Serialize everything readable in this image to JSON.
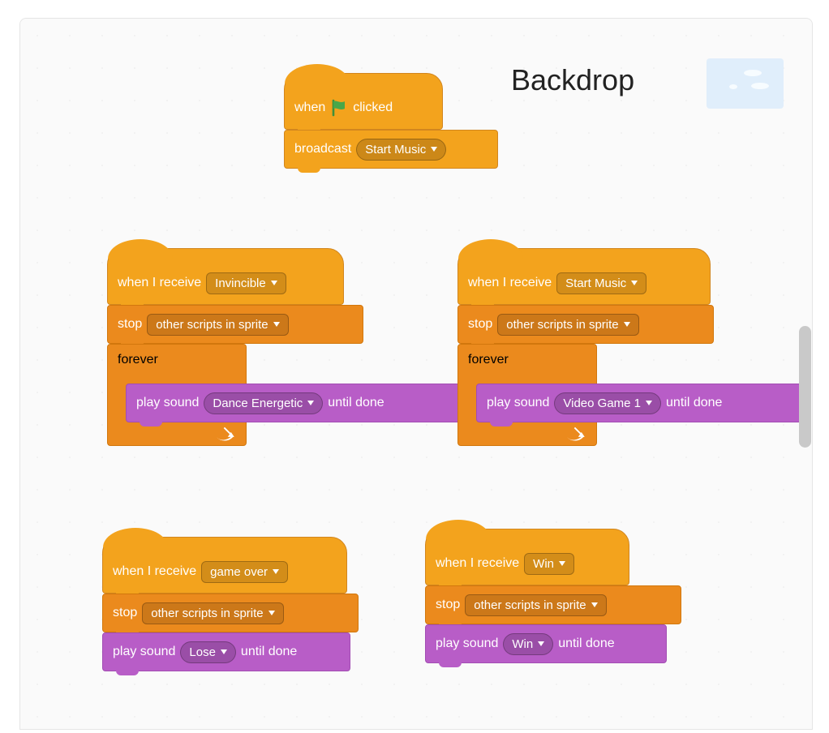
{
  "title": "Backdrop",
  "colors": {
    "events": "#f3a31d",
    "control": "#eb8a1d",
    "sound": "#b85dc7"
  },
  "labels": {
    "when": "when",
    "clicked": "clicked",
    "broadcast": "broadcast",
    "when_i_receive": "when I receive",
    "stop": "stop",
    "forever": "forever",
    "play_sound": "play sound",
    "until_done": "until done"
  },
  "dropdowns": {
    "start_music": "Start Music",
    "invincible": "Invincible",
    "other_scripts": "other scripts in sprite",
    "dance_energetic": "Dance Energetic",
    "video_game_1": "Video Game 1",
    "game_over": "game over",
    "win": "Win",
    "lose": "Lose"
  }
}
